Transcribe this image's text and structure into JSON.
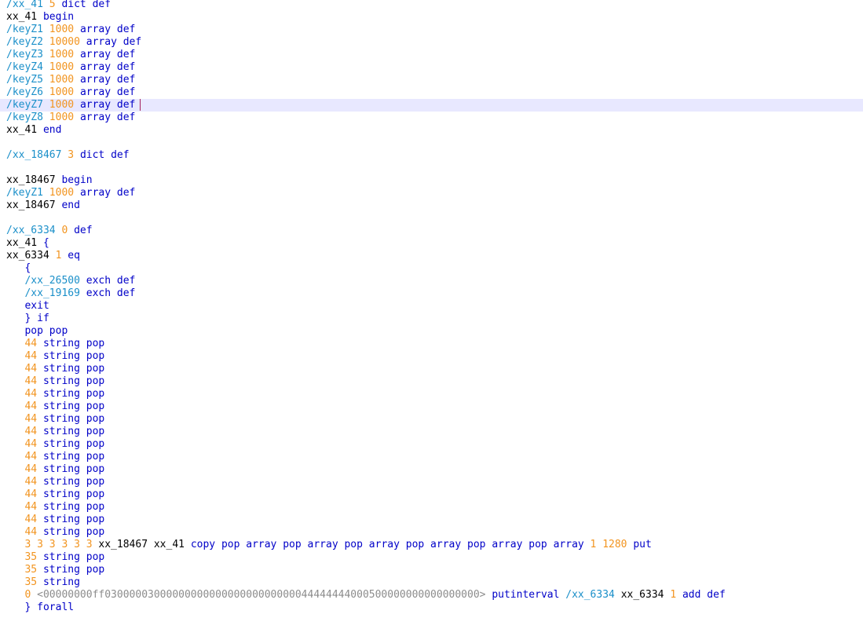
{
  "colors": {
    "literal": "#1a8fc9",
    "number": "#f2941f",
    "keyword": "#0000c8",
    "plain": "#000000",
    "hexstring": "#8c8c8c",
    "current_line": "#e8e8ff",
    "caret": "#a3215f"
  },
  "editor": {
    "current_line_index": 8,
    "lines": [
      [
        [
          "lit",
          "/xx_41"
        ],
        [
          "sp",
          " "
        ],
        [
          "num",
          "5"
        ],
        [
          "sp",
          " "
        ],
        [
          "kw",
          "dict def"
        ]
      ],
      [
        [
          "plain",
          "xx_41"
        ],
        [
          "sp",
          " "
        ],
        [
          "kw",
          "begin"
        ]
      ],
      [
        [
          "lit",
          "/keyZ1"
        ],
        [
          "sp",
          " "
        ],
        [
          "num",
          "1000"
        ],
        [
          "sp",
          " "
        ],
        [
          "kw",
          "array def"
        ]
      ],
      [
        [
          "lit",
          "/keyZ2"
        ],
        [
          "sp",
          " "
        ],
        [
          "num",
          "10000"
        ],
        [
          "sp",
          " "
        ],
        [
          "kw",
          "array def"
        ]
      ],
      [
        [
          "lit",
          "/keyZ3"
        ],
        [
          "sp",
          " "
        ],
        [
          "num",
          "1000"
        ],
        [
          "sp",
          " "
        ],
        [
          "kw",
          "array def"
        ]
      ],
      [
        [
          "lit",
          "/keyZ4"
        ],
        [
          "sp",
          " "
        ],
        [
          "num",
          "1000"
        ],
        [
          "sp",
          " "
        ],
        [
          "kw",
          "array def"
        ]
      ],
      [
        [
          "lit",
          "/keyZ5"
        ],
        [
          "sp",
          " "
        ],
        [
          "num",
          "1000"
        ],
        [
          "sp",
          " "
        ],
        [
          "kw",
          "array def"
        ]
      ],
      [
        [
          "lit",
          "/keyZ6"
        ],
        [
          "sp",
          " "
        ],
        [
          "num",
          "1000"
        ],
        [
          "sp",
          " "
        ],
        [
          "kw",
          "array def"
        ]
      ],
      [
        [
          "lit",
          "/keyZ7"
        ],
        [
          "sp",
          " "
        ],
        [
          "num",
          "1000"
        ],
        [
          "sp",
          " "
        ],
        [
          "kw",
          "array def"
        ]
      ],
      [
        [
          "lit",
          "/keyZ8"
        ],
        [
          "sp",
          " "
        ],
        [
          "num",
          "1000"
        ],
        [
          "sp",
          " "
        ],
        [
          "kw",
          "array def"
        ]
      ],
      [
        [
          "plain",
          "xx_41"
        ],
        [
          "sp",
          " "
        ],
        [
          "kw",
          "end"
        ]
      ],
      [],
      [
        [
          "lit",
          "/xx_18467"
        ],
        [
          "sp",
          " "
        ],
        [
          "num",
          "3"
        ],
        [
          "sp",
          " "
        ],
        [
          "kw",
          "dict def"
        ]
      ],
      [],
      [
        [
          "plain",
          "xx_18467"
        ],
        [
          "sp",
          " "
        ],
        [
          "kw",
          "begin"
        ]
      ],
      [
        [
          "lit",
          "/keyZ1"
        ],
        [
          "sp",
          " "
        ],
        [
          "num",
          "1000"
        ],
        [
          "sp",
          " "
        ],
        [
          "kw",
          "array def"
        ]
      ],
      [
        [
          "plain",
          "xx_18467"
        ],
        [
          "sp",
          " "
        ],
        [
          "kw",
          "end"
        ]
      ],
      [],
      [
        [
          "lit",
          "/xx_6334"
        ],
        [
          "sp",
          " "
        ],
        [
          "num",
          "0"
        ],
        [
          "sp",
          " "
        ],
        [
          "kw",
          "def"
        ]
      ],
      [
        [
          "plain",
          "xx_41"
        ],
        [
          "sp",
          " "
        ],
        [
          "kw",
          "{"
        ]
      ],
      [
        [
          "plain",
          "xx_6334"
        ],
        [
          "sp",
          " "
        ],
        [
          "num",
          "1"
        ],
        [
          "sp",
          " "
        ],
        [
          "kw",
          "eq"
        ]
      ],
      [
        [
          "sp",
          "   "
        ],
        [
          "kw",
          "{"
        ]
      ],
      [
        [
          "sp",
          "   "
        ],
        [
          "lit",
          "/xx_26500"
        ],
        [
          "sp",
          " "
        ],
        [
          "kw",
          "exch def"
        ]
      ],
      [
        [
          "sp",
          "   "
        ],
        [
          "lit",
          "/xx_19169"
        ],
        [
          "sp",
          " "
        ],
        [
          "kw",
          "exch def"
        ]
      ],
      [
        [
          "sp",
          "   "
        ],
        [
          "kw",
          "exit"
        ]
      ],
      [
        [
          "sp",
          "   "
        ],
        [
          "kw",
          "} if"
        ]
      ],
      [
        [
          "sp",
          "   "
        ],
        [
          "kw",
          "pop pop"
        ]
      ],
      [
        [
          "sp",
          "   "
        ],
        [
          "num",
          "44"
        ],
        [
          "sp",
          " "
        ],
        [
          "kw",
          "string pop"
        ]
      ],
      [
        [
          "sp",
          "   "
        ],
        [
          "num",
          "44"
        ],
        [
          "sp",
          " "
        ],
        [
          "kw",
          "string pop"
        ]
      ],
      [
        [
          "sp",
          "   "
        ],
        [
          "num",
          "44"
        ],
        [
          "sp",
          " "
        ],
        [
          "kw",
          "string pop"
        ]
      ],
      [
        [
          "sp",
          "   "
        ],
        [
          "num",
          "44"
        ],
        [
          "sp",
          " "
        ],
        [
          "kw",
          "string pop"
        ]
      ],
      [
        [
          "sp",
          "   "
        ],
        [
          "num",
          "44"
        ],
        [
          "sp",
          " "
        ],
        [
          "kw",
          "string pop"
        ]
      ],
      [
        [
          "sp",
          "   "
        ],
        [
          "num",
          "44"
        ],
        [
          "sp",
          " "
        ],
        [
          "kw",
          "string pop"
        ]
      ],
      [
        [
          "sp",
          "   "
        ],
        [
          "num",
          "44"
        ],
        [
          "sp",
          " "
        ],
        [
          "kw",
          "string pop"
        ]
      ],
      [
        [
          "sp",
          "   "
        ],
        [
          "num",
          "44"
        ],
        [
          "sp",
          " "
        ],
        [
          "kw",
          "string pop"
        ]
      ],
      [
        [
          "sp",
          "   "
        ],
        [
          "num",
          "44"
        ],
        [
          "sp",
          " "
        ],
        [
          "kw",
          "string pop"
        ]
      ],
      [
        [
          "sp",
          "   "
        ],
        [
          "num",
          "44"
        ],
        [
          "sp",
          " "
        ],
        [
          "kw",
          "string pop"
        ]
      ],
      [
        [
          "sp",
          "   "
        ],
        [
          "num",
          "44"
        ],
        [
          "sp",
          " "
        ],
        [
          "kw",
          "string pop"
        ]
      ],
      [
        [
          "sp",
          "   "
        ],
        [
          "num",
          "44"
        ],
        [
          "sp",
          " "
        ],
        [
          "kw",
          "string pop"
        ]
      ],
      [
        [
          "sp",
          "   "
        ],
        [
          "num",
          "44"
        ],
        [
          "sp",
          " "
        ],
        [
          "kw",
          "string pop"
        ]
      ],
      [
        [
          "sp",
          "   "
        ],
        [
          "num",
          "44"
        ],
        [
          "sp",
          " "
        ],
        [
          "kw",
          "string pop"
        ]
      ],
      [
        [
          "sp",
          "   "
        ],
        [
          "num",
          "44"
        ],
        [
          "sp",
          " "
        ],
        [
          "kw",
          "string pop"
        ]
      ],
      [
        [
          "sp",
          "   "
        ],
        [
          "num",
          "44"
        ],
        [
          "sp",
          " "
        ],
        [
          "kw",
          "string pop"
        ]
      ],
      [
        [
          "sp",
          "   "
        ],
        [
          "num",
          "3 3 3 3 3 3"
        ],
        [
          "sp",
          " "
        ],
        [
          "plain",
          "xx_18467 xx_41"
        ],
        [
          "sp",
          " "
        ],
        [
          "kw",
          "copy pop array pop array pop array pop array pop array pop array"
        ],
        [
          "sp",
          " "
        ],
        [
          "num",
          "1 1280"
        ],
        [
          "sp",
          " "
        ],
        [
          "kw",
          "put"
        ]
      ],
      [
        [
          "sp",
          "   "
        ],
        [
          "num",
          "35"
        ],
        [
          "sp",
          " "
        ],
        [
          "kw",
          "string pop"
        ]
      ],
      [
        [
          "sp",
          "   "
        ],
        [
          "num",
          "35"
        ],
        [
          "sp",
          " "
        ],
        [
          "kw",
          "string pop"
        ]
      ],
      [
        [
          "sp",
          "   "
        ],
        [
          "num",
          "35"
        ],
        [
          "sp",
          " "
        ],
        [
          "kw",
          "string"
        ]
      ],
      [
        [
          "sp",
          "   "
        ],
        [
          "num",
          "0"
        ],
        [
          "sp",
          " "
        ],
        [
          "hex",
          "<00000000ff0300000300000000000000000000000044444444000500000000000000000>"
        ],
        [
          "sp",
          " "
        ],
        [
          "kw",
          "putinterval"
        ],
        [
          "sp",
          " "
        ],
        [
          "lit",
          "/xx_6334"
        ],
        [
          "sp",
          " "
        ],
        [
          "plain",
          "xx_6334"
        ],
        [
          "sp",
          " "
        ],
        [
          "num",
          "1"
        ],
        [
          "sp",
          " "
        ],
        [
          "kw",
          "add def"
        ]
      ],
      [
        [
          "sp",
          "   "
        ],
        [
          "kw",
          "} forall"
        ]
      ]
    ]
  }
}
